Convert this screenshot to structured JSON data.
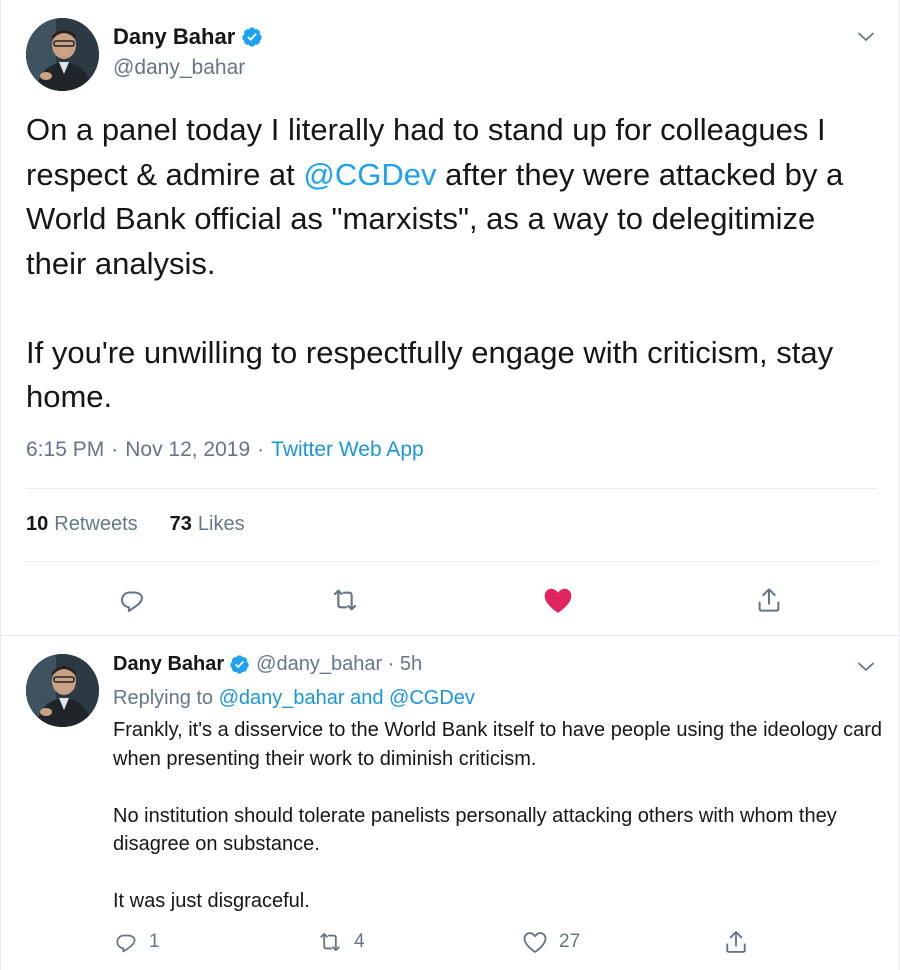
{
  "main_tweet": {
    "author_name": "Dany Bahar",
    "author_handle": "@dany_bahar",
    "text_part1": "On a panel today I literally had to stand up for colleagues I respect & admire at ",
    "mention": "@CGDev",
    "text_part2": " after they were attacked by a World Bank official as \"marxists\", as a way to delegitimize their analysis.\n\nIf you're unwilling to respectfully engage with criticism, stay home.",
    "time": "6:15 PM",
    "date": "Nov 12, 2019",
    "separator": "·",
    "source": "Twitter Web App",
    "retweets_count": "10",
    "retweets_label": "Retweets",
    "likes_count": "73",
    "likes_label": "Likes",
    "liked": true,
    "accent_color": "#1da1f2",
    "like_color": "#e0245e"
  },
  "reply_tweet": {
    "author_name": "Dany Bahar",
    "handle_time": "@dany_bahar · 5h",
    "replying_prefix": "Replying to ",
    "replying_to": "@dany_bahar and @CGDev",
    "text": "Frankly, it's a disservice to the World Bank itself to have people using the ideology card when presenting their work to diminish criticism.\n\nNo institution should tolerate panelists personally attacking others with whom they disagree on substance.\n\nIt was just disgraceful.",
    "reply_count": "1",
    "retweet_count": "4",
    "like_count": "27"
  }
}
